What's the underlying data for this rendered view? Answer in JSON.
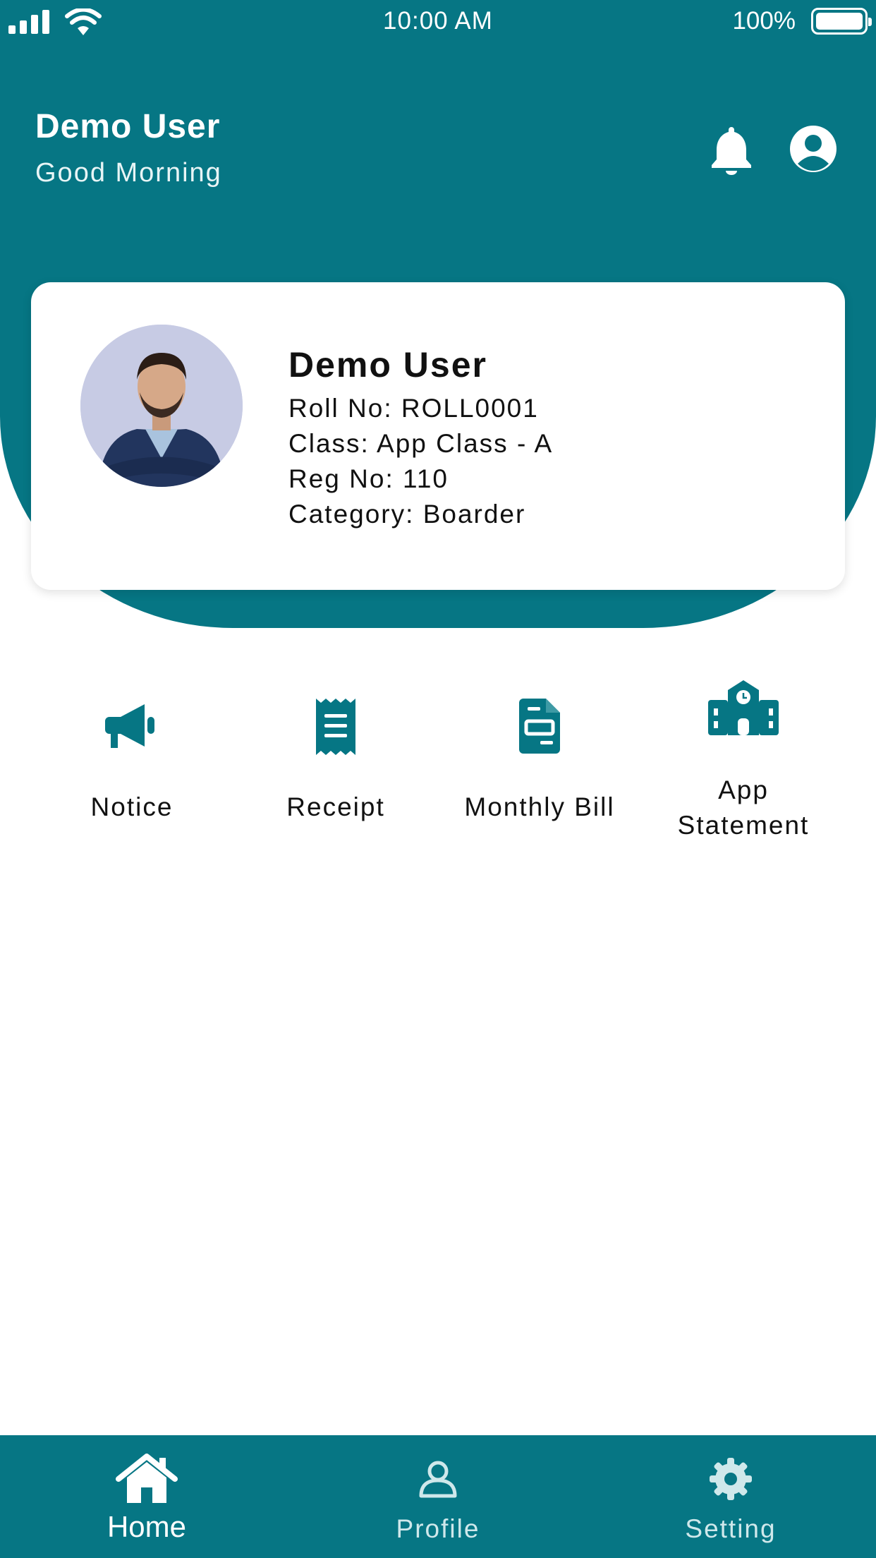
{
  "status_bar": {
    "time": "10:00 AM",
    "battery": "100%"
  },
  "header": {
    "user_name": "Demo User",
    "greeting": "Good Morning",
    "icons": [
      "bell-icon",
      "account-icon"
    ]
  },
  "profile_card": {
    "name": "Demo User",
    "roll_no": "Roll No: ROLL0001",
    "class": "Class: App Class - A",
    "reg_no": "Reg No: 110",
    "category": "Category: Boarder"
  },
  "menu": {
    "notice": "Notice",
    "receipt": "Receipt",
    "monthly_bill": "Monthly Bill",
    "app_statement_line1": "App",
    "app_statement_line2": "Statement"
  },
  "bottom_nav": {
    "home": "Home",
    "profile": "Profile",
    "setting": "Setting",
    "active": "Home"
  },
  "colors": {
    "primary": "#067684",
    "card_bg": "#ffffff",
    "inactive_nav": "#cfe8eb"
  }
}
